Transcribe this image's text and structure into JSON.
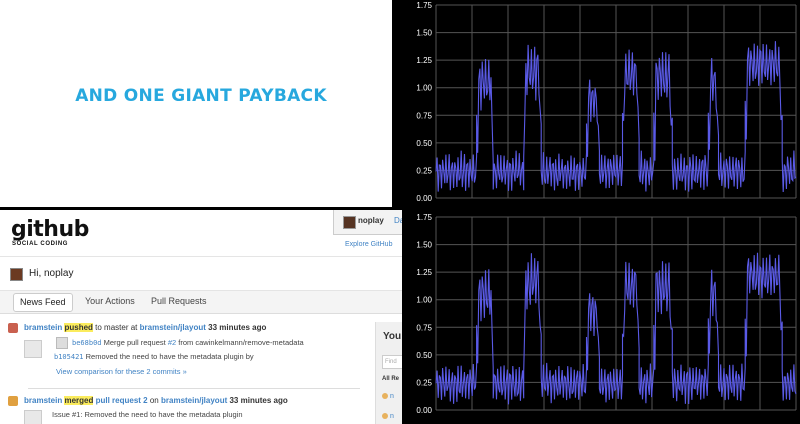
{
  "slide": {
    "text": "AND ONE GIANT PAYBACK"
  },
  "github": {
    "logo_word": "github",
    "logo_sub": "SOCIAL CODING",
    "user_name": "noplay",
    "user_extra": "Da",
    "explore": "Explore GitHub",
    "greeting": "Hi, noplay",
    "tabs": [
      "News Feed",
      "Your Actions",
      "Pull Requests"
    ],
    "sidebar": {
      "title": "You",
      "input_placeholder": "Find",
      "filter": "All Re",
      "items": [
        "n",
        "n"
      ]
    },
    "events": [
      {
        "actor": "bramstein",
        "action": "pushed",
        "mid": "to master at",
        "repo": "bramstein/jlayout",
        "time": "33 minutes ago",
        "commits": [
          {
            "sha": "be68b0d",
            "pre": "Merge pull request ",
            "link": "#2",
            "post": " from cawinkelmann/remove-metadata"
          },
          {
            "sha": "b105421",
            "pre": "Removed the need to have the metadata plugin by",
            "link": "",
            "post": ""
          }
        ],
        "compare": "View comparison for these 2 commits »"
      },
      {
        "actor": "bramstein",
        "action": "merged",
        "mid1": "pull request 2",
        "mid2": "on",
        "repo": "bramstein/jlayout",
        "time": "33 minutes ago",
        "detail": "Issue #1: Removed the need to have the metadata plugin"
      }
    ]
  },
  "charts": [
    {
      "name": "top",
      "chart_data": {
        "type": "line",
        "ylim": [
          0,
          1.75
        ],
        "yticks": [
          "0.00",
          "0.25",
          "0.50",
          "0.75",
          "1.00",
          "1.25",
          "1.50",
          "1.75"
        ],
        "grid": true,
        "color": "#5a5ae6",
        "segments": [
          {
            "x0": 0,
            "x1": 44,
            "level": "low",
            "center": 0.24,
            "amp": 0.16
          },
          {
            "x0": 44,
            "x1": 62,
            "level": "high",
            "center": 1.05,
            "amp": 0.22
          },
          {
            "x0": 62,
            "x1": 95,
            "level": "low",
            "center": 0.24,
            "amp": 0.16
          },
          {
            "x0": 95,
            "x1": 114,
            "level": "high",
            "center": 1.15,
            "amp": 0.25
          },
          {
            "x0": 114,
            "x1": 163,
            "level": "low",
            "center": 0.24,
            "amp": 0.16
          },
          {
            "x0": 163,
            "x1": 177,
            "level": "high",
            "center": 0.9,
            "amp": 0.2
          },
          {
            "x0": 177,
            "x1": 202,
            "level": "low",
            "center": 0.24,
            "amp": 0.16
          },
          {
            "x0": 202,
            "x1": 220,
            "level": "high",
            "center": 1.12,
            "amp": 0.22
          },
          {
            "x0": 220,
            "x1": 236,
            "level": "low",
            "center": 0.24,
            "amp": 0.16
          },
          {
            "x0": 236,
            "x1": 256,
            "level": "high",
            "center": 1.1,
            "amp": 0.24
          },
          {
            "x0": 256,
            "x1": 295,
            "level": "low",
            "center": 0.24,
            "amp": 0.16
          },
          {
            "x0": 295,
            "x1": 306,
            "level": "high",
            "center": 1.05,
            "amp": 0.23
          },
          {
            "x0": 306,
            "x1": 335,
            "level": "low",
            "center": 0.24,
            "amp": 0.16
          },
          {
            "x0": 335,
            "x1": 375,
            "level": "high",
            "center": 1.22,
            "amp": 0.2
          },
          {
            "x0": 375,
            "x1": 390,
            "level": "low",
            "center": 0.24,
            "amp": 0.16
          }
        ]
      }
    },
    {
      "name": "bottom",
      "chart_data": {
        "type": "line",
        "ylim": [
          0,
          1.75
        ],
        "yticks": [
          "0.00",
          "0.25",
          "0.50",
          "0.75",
          "1.00",
          "1.25",
          "1.50",
          "1.75"
        ],
        "grid": true,
        "color": "#5a5ae6",
        "segments": [
          {
            "x0": 0,
            "x1": 44,
            "level": "low",
            "center": 0.24,
            "amp": 0.16
          },
          {
            "x0": 44,
            "x1": 62,
            "level": "high",
            "center": 1.05,
            "amp": 0.22
          },
          {
            "x0": 62,
            "x1": 95,
            "level": "low",
            "center": 0.24,
            "amp": 0.16
          },
          {
            "x0": 95,
            "x1": 114,
            "level": "high",
            "center": 1.15,
            "amp": 0.25
          },
          {
            "x0": 114,
            "x1": 163,
            "level": "low",
            "center": 0.24,
            "amp": 0.16
          },
          {
            "x0": 163,
            "x1": 177,
            "level": "high",
            "center": 0.9,
            "amp": 0.2
          },
          {
            "x0": 177,
            "x1": 202,
            "level": "low",
            "center": 0.24,
            "amp": 0.16
          },
          {
            "x0": 202,
            "x1": 220,
            "level": "high",
            "center": 1.12,
            "amp": 0.22
          },
          {
            "x0": 220,
            "x1": 236,
            "level": "low",
            "center": 0.24,
            "amp": 0.16
          },
          {
            "x0": 236,
            "x1": 256,
            "level": "high",
            "center": 1.1,
            "amp": 0.24
          },
          {
            "x0": 256,
            "x1": 295,
            "level": "low",
            "center": 0.24,
            "amp": 0.16
          },
          {
            "x0": 295,
            "x1": 306,
            "level": "high",
            "center": 1.05,
            "amp": 0.23
          },
          {
            "x0": 306,
            "x1": 335,
            "level": "low",
            "center": 0.24,
            "amp": 0.16
          },
          {
            "x0": 335,
            "x1": 375,
            "level": "high",
            "center": 1.22,
            "amp": 0.2
          },
          {
            "x0": 375,
            "x1": 390,
            "level": "low",
            "center": 0.24,
            "amp": 0.16
          }
        ]
      }
    }
  ]
}
